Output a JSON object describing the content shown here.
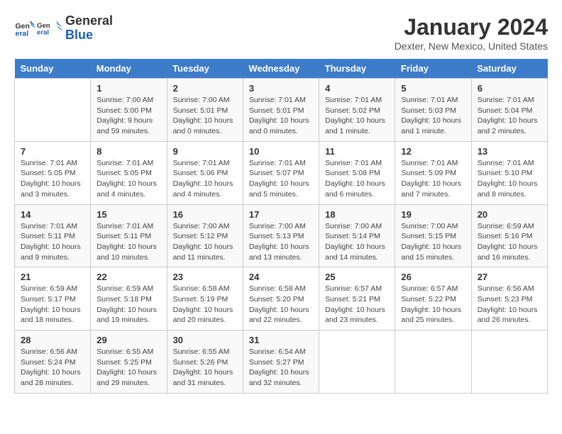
{
  "header": {
    "logo_line1": "General",
    "logo_line2": "Blue",
    "title": "January 2024",
    "subtitle": "Dexter, New Mexico, United States"
  },
  "days_of_week": [
    "Sunday",
    "Monday",
    "Tuesday",
    "Wednesday",
    "Thursday",
    "Friday",
    "Saturday"
  ],
  "weeks": [
    [
      {
        "day": "",
        "info": ""
      },
      {
        "day": "1",
        "info": "Sunrise: 7:00 AM\nSunset: 5:00 PM\nDaylight: 9 hours and 59 minutes."
      },
      {
        "day": "2",
        "info": "Sunrise: 7:00 AM\nSunset: 5:01 PM\nDaylight: 10 hours and 0 minutes."
      },
      {
        "day": "3",
        "info": "Sunrise: 7:01 AM\nSunset: 5:01 PM\nDaylight: 10 hours and 0 minutes."
      },
      {
        "day": "4",
        "info": "Sunrise: 7:01 AM\nSunset: 5:02 PM\nDaylight: 10 hours and 1 minute."
      },
      {
        "day": "5",
        "info": "Sunrise: 7:01 AM\nSunset: 5:03 PM\nDaylight: 10 hours and 1 minute."
      },
      {
        "day": "6",
        "info": "Sunrise: 7:01 AM\nSunset: 5:04 PM\nDaylight: 10 hours and 2 minutes."
      }
    ],
    [
      {
        "day": "7",
        "info": "Sunrise: 7:01 AM\nSunset: 5:05 PM\nDaylight: 10 hours and 3 minutes."
      },
      {
        "day": "8",
        "info": "Sunrise: 7:01 AM\nSunset: 5:05 PM\nDaylight: 10 hours and 4 minutes."
      },
      {
        "day": "9",
        "info": "Sunrise: 7:01 AM\nSunset: 5:06 PM\nDaylight: 10 hours and 4 minutes."
      },
      {
        "day": "10",
        "info": "Sunrise: 7:01 AM\nSunset: 5:07 PM\nDaylight: 10 hours and 5 minutes."
      },
      {
        "day": "11",
        "info": "Sunrise: 7:01 AM\nSunset: 5:08 PM\nDaylight: 10 hours and 6 minutes."
      },
      {
        "day": "12",
        "info": "Sunrise: 7:01 AM\nSunset: 5:09 PM\nDaylight: 10 hours and 7 minutes."
      },
      {
        "day": "13",
        "info": "Sunrise: 7:01 AM\nSunset: 5:10 PM\nDaylight: 10 hours and 8 minutes."
      }
    ],
    [
      {
        "day": "14",
        "info": "Sunrise: 7:01 AM\nSunset: 5:11 PM\nDaylight: 10 hours and 9 minutes."
      },
      {
        "day": "15",
        "info": "Sunrise: 7:01 AM\nSunset: 5:11 PM\nDaylight: 10 hours and 10 minutes."
      },
      {
        "day": "16",
        "info": "Sunrise: 7:00 AM\nSunset: 5:12 PM\nDaylight: 10 hours and 11 minutes."
      },
      {
        "day": "17",
        "info": "Sunrise: 7:00 AM\nSunset: 5:13 PM\nDaylight: 10 hours and 13 minutes."
      },
      {
        "day": "18",
        "info": "Sunrise: 7:00 AM\nSunset: 5:14 PM\nDaylight: 10 hours and 14 minutes."
      },
      {
        "day": "19",
        "info": "Sunrise: 7:00 AM\nSunset: 5:15 PM\nDaylight: 10 hours and 15 minutes."
      },
      {
        "day": "20",
        "info": "Sunrise: 6:59 AM\nSunset: 5:16 PM\nDaylight: 10 hours and 16 minutes."
      }
    ],
    [
      {
        "day": "21",
        "info": "Sunrise: 6:59 AM\nSunset: 5:17 PM\nDaylight: 10 hours and 18 minutes."
      },
      {
        "day": "22",
        "info": "Sunrise: 6:59 AM\nSunset: 5:18 PM\nDaylight: 10 hours and 19 minutes."
      },
      {
        "day": "23",
        "info": "Sunrise: 6:58 AM\nSunset: 5:19 PM\nDaylight: 10 hours and 20 minutes."
      },
      {
        "day": "24",
        "info": "Sunrise: 6:58 AM\nSunset: 5:20 PM\nDaylight: 10 hours and 22 minutes."
      },
      {
        "day": "25",
        "info": "Sunrise: 6:57 AM\nSunset: 5:21 PM\nDaylight: 10 hours and 23 minutes."
      },
      {
        "day": "26",
        "info": "Sunrise: 6:57 AM\nSunset: 5:22 PM\nDaylight: 10 hours and 25 minutes."
      },
      {
        "day": "27",
        "info": "Sunrise: 6:56 AM\nSunset: 5:23 PM\nDaylight: 10 hours and 26 minutes."
      }
    ],
    [
      {
        "day": "28",
        "info": "Sunrise: 6:56 AM\nSunset: 5:24 PM\nDaylight: 10 hours and 28 minutes."
      },
      {
        "day": "29",
        "info": "Sunrise: 6:55 AM\nSunset: 5:25 PM\nDaylight: 10 hours and 29 minutes."
      },
      {
        "day": "30",
        "info": "Sunrise: 6:55 AM\nSunset: 5:26 PM\nDaylight: 10 hours and 31 minutes."
      },
      {
        "day": "31",
        "info": "Sunrise: 6:54 AM\nSunset: 5:27 PM\nDaylight: 10 hours and 32 minutes."
      },
      {
        "day": "",
        "info": ""
      },
      {
        "day": "",
        "info": ""
      },
      {
        "day": "",
        "info": ""
      }
    ]
  ]
}
